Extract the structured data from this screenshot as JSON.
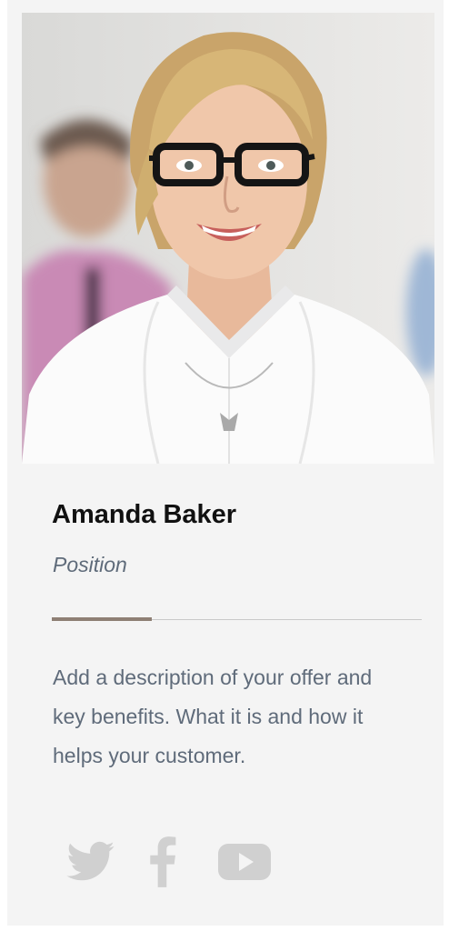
{
  "member": {
    "photo_icon": "team-member-photo",
    "name": "Amanda Baker",
    "position": "Position",
    "description": "Add a description of your offer and key benefits. What it is and how it helps your customer."
  },
  "colors": {
    "card_background": "#f4f4f4",
    "name": "#111111",
    "secondary_text": "#5f6b7a",
    "divider": "#c9c9c9",
    "divider_accent": "#8e7f74",
    "social_icons": "#d0d0d0"
  },
  "social": [
    {
      "icon": "twitter-icon"
    },
    {
      "icon": "facebook-icon"
    },
    {
      "icon": "youtube-icon"
    }
  ]
}
